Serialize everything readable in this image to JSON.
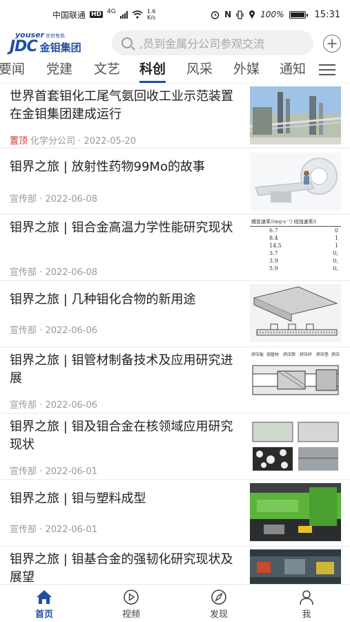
{
  "status_bar": {
    "carrier": "中国联通",
    "hd": "HD",
    "network": "4G",
    "speed_value": "1.6",
    "speed_unit": "K/s",
    "nfc": "N",
    "battery_percent": "100%",
    "time": "15:31"
  },
  "header": {
    "logo_top": "youser",
    "logo_top_cn": "优世有色",
    "logo_main": "JDC",
    "logo_cn": "金钼集团",
    "search_placeholder": ",员到金属分公司参观交流"
  },
  "tabs": [
    {
      "label": "要闻"
    },
    {
      "label": "党建"
    },
    {
      "label": "文艺"
    },
    {
      "label": "科创"
    },
    {
      "label": "风采"
    },
    {
      "label": "外媒"
    },
    {
      "label": "通知"
    }
  ],
  "active_tab": "科创",
  "articles": [
    {
      "title": "世界首套钼化工尾气氨回收工业示范装置在金钼集团建成运行",
      "pin": "置顶",
      "source": "化学分公司",
      "date": "2022-05-20",
      "thumb": "industrial-plant"
    },
    {
      "title": "钼界之旅 | 放射性药物99Mo的故事",
      "source": "宣传部",
      "date": "2022-06-08",
      "thumb": "medical-scanner"
    },
    {
      "title": "钼界之旅 | 钼合金高温力学性能研究现状",
      "source": "宣传部",
      "date": "2022-06-08",
      "thumb": "data-table",
      "table_header": "蠕变速率/(mg·s⁻¹)    线蚀速率/(",
      "table_rows": [
        [
          "6.7",
          "0"
        ],
        [
          "8.4",
          "1"
        ],
        [
          "14.5",
          "1"
        ],
        [
          "3.7",
          "0,"
        ],
        [
          "3.9",
          "0,"
        ],
        [
          "5.9",
          "0,"
        ]
      ]
    },
    {
      "title": "钼界之旅 | 几种钼化合物的新用途",
      "source": "宣传部",
      "date": "2022-06-06",
      "thumb": "technical-drawing"
    },
    {
      "title": "钼界之旅 | 钼管材制备技术及应用研究进展",
      "source": "宣传部",
      "date": "2022-06-06",
      "thumb": "tube-diagram",
      "diagram_labels": [
        "挤压板",
        "钼管材",
        "挤压筒",
        "挤压杆",
        "挤压垫",
        "挤压"
      ]
    },
    {
      "title": "钼界之旅 | 钼及钼合金在核领域应用研究现状",
      "source": "宣传部",
      "date": "2022-06-01",
      "thumb": "micrographs"
    },
    {
      "title": "钼界之旅 | 钼与塑料成型",
      "source": "宣传部",
      "date": "2022-06-01",
      "thumb": "molding-machine"
    },
    {
      "title": "钼界之旅 | 钼基合金的强韧化研究现状及展望",
      "source": "",
      "date": "",
      "thumb": "machinery"
    }
  ],
  "meta_separator": "·",
  "bottom_nav": [
    {
      "label": "首页",
      "icon": "home-icon"
    },
    {
      "label": "视频",
      "icon": "play-icon"
    },
    {
      "label": "发现",
      "icon": "compass-icon"
    },
    {
      "label": "我",
      "icon": "user-icon"
    }
  ],
  "colors": {
    "brand": "#1f4fa3",
    "pin": "#d0352c",
    "background": "#f2f2f2"
  }
}
